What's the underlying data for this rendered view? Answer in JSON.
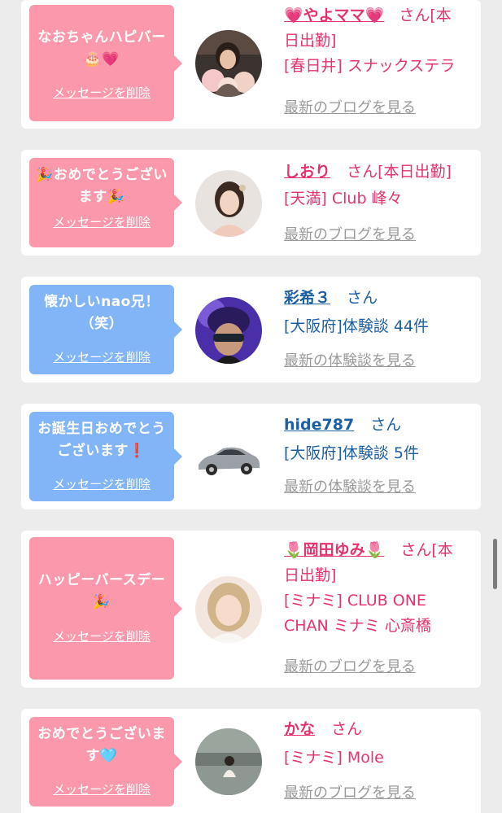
{
  "cards": [
    {
      "bubble_color": "pink",
      "message": "なおちゃんハピバー🎂💗",
      "delete_label": "メッセージを削除",
      "name": "💗やよママ💗",
      "honorific": "さん",
      "status": "[本日出勤]",
      "location": "[春日井] スナックステラ",
      "recent_link": "最新のブログを見る"
    },
    {
      "bubble_color": "pink",
      "message": "🎉おめでとうございます🎉",
      "delete_label": "メッセージを削除",
      "name": "しおり",
      "honorific": "さん",
      "status": "[本日出勤]",
      "location": "[天満] Club 峰々",
      "recent_link": "最新のブログを見る"
    },
    {
      "bubble_color": "blue",
      "message": "懐かしいnao兄！（笑）",
      "delete_label": "メッセージを削除",
      "name": "彩希３",
      "honorific": "さん",
      "location": "[大阪府]体験談 44件",
      "recent_link": "最新の体験談を見る"
    },
    {
      "bubble_color": "blue",
      "message": "お誕生日おめでとうございます❗",
      "delete_label": "メッセージを削除",
      "name": "hide787",
      "honorific": "さん",
      "location": "[大阪府]体験談 5件",
      "recent_link": "最新の体験談を見る"
    },
    {
      "bubble_color": "pink",
      "message": "ハッピーバースデー🎉",
      "delete_label": "メッセージを削除",
      "name": "🌷岡田ゆみ🌷",
      "honorific": "さん",
      "status": "[本日出勤]",
      "location": "[ミナミ] CLUB ONE CHAN ミナミ 心斎橋",
      "recent_link": "最新のブログを見る"
    },
    {
      "bubble_color": "pink",
      "message": "おめでとうございます🩵",
      "delete_label": "メッセージを削除",
      "name": "かな",
      "honorific": "さん",
      "location": "[ミナミ] Mole",
      "recent_link": "最新のブログを見る"
    }
  ],
  "colors": {
    "bubble_pink": "#fc98ab",
    "bubble_blue": "#82b5f7",
    "name_pink": "#e5336d",
    "name_blue": "#1d5fa3",
    "link_gray": "#9a9a9a",
    "background": "#ececec"
  }
}
